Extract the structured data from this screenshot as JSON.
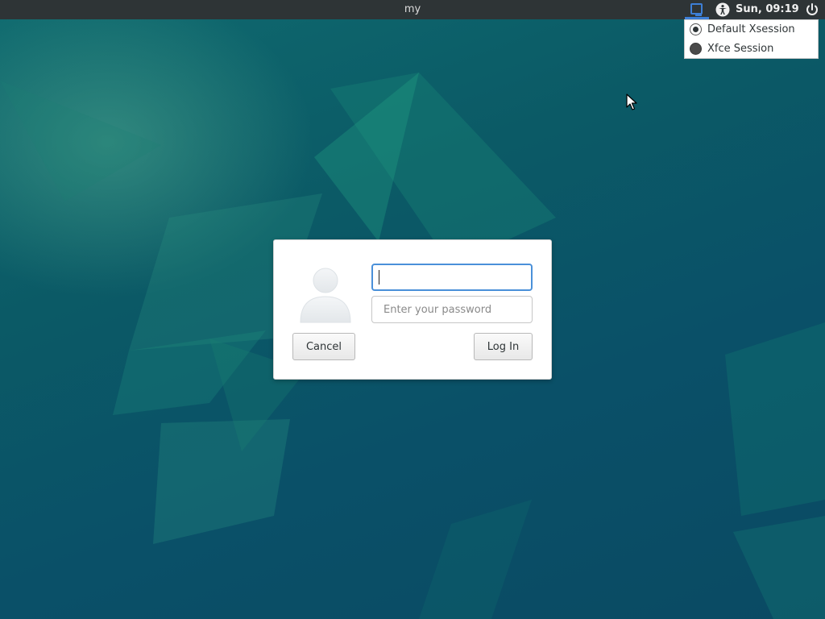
{
  "panel": {
    "hostname": "my",
    "clock": "Sun, 09:19",
    "icons": {
      "session": "session-select-icon",
      "accessibility": "accessibility-icon",
      "power": "power-icon"
    }
  },
  "session_menu": {
    "items": [
      {
        "label": "Default Xsession",
        "selected": true
      },
      {
        "label": "Xfce Session",
        "selected": false
      }
    ]
  },
  "login": {
    "username_value": "",
    "password_placeholder": "Enter your password",
    "cancel_label": "Cancel",
    "login_label": "Log In"
  },
  "colors": {
    "panel_bg": "#2e3436",
    "wallpaper": "#0b5a66",
    "focus_border": "#4a90d9"
  }
}
